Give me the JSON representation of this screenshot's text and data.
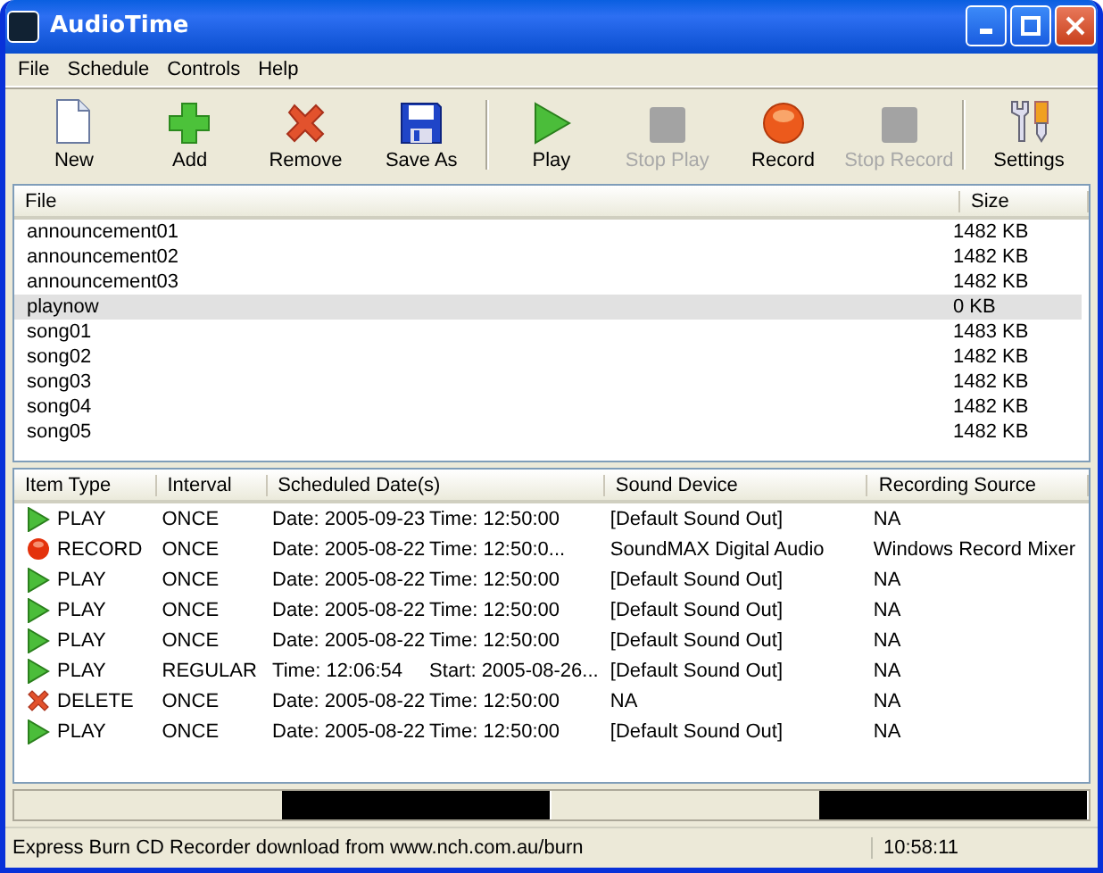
{
  "window": {
    "title": "AudioTime"
  },
  "menu": [
    "File",
    "Schedule",
    "Controls",
    "Help"
  ],
  "toolbar": [
    {
      "kind": "new",
      "label": "New",
      "disabled": false
    },
    {
      "kind": "add",
      "label": "Add",
      "disabled": false
    },
    {
      "kind": "remove",
      "label": "Remove",
      "disabled": false
    },
    {
      "kind": "save",
      "label": "Save As",
      "disabled": false
    },
    {
      "kind": "separator"
    },
    {
      "kind": "play",
      "label": "Play",
      "disabled": false
    },
    {
      "kind": "stop",
      "label": "Stop Play",
      "disabled": true
    },
    {
      "kind": "record",
      "label": "Record",
      "disabled": false
    },
    {
      "kind": "stop",
      "label": "Stop Record",
      "disabled": true
    },
    {
      "kind": "separator"
    },
    {
      "kind": "settings",
      "label": "Settings",
      "disabled": false
    }
  ],
  "files": {
    "columns": [
      "File",
      "Size"
    ],
    "rows": [
      {
        "name": "announcement01",
        "size": "1482 KB",
        "selected": false
      },
      {
        "name": "announcement02",
        "size": "1482 KB",
        "selected": false
      },
      {
        "name": "announcement03",
        "size": "1482 KB",
        "selected": false
      },
      {
        "name": "playnow",
        "size": "0 KB",
        "selected": true
      },
      {
        "name": "song01",
        "size": "1483 KB",
        "selected": false
      },
      {
        "name": "song02",
        "size": "1482 KB",
        "selected": false
      },
      {
        "name": "song03",
        "size": "1482 KB",
        "selected": false
      },
      {
        "name": "song04",
        "size": "1482 KB",
        "selected": false
      },
      {
        "name": "song05",
        "size": "1482 KB",
        "selected": false
      }
    ]
  },
  "schedule": {
    "columns": [
      "Item Type",
      "Interval",
      "Scheduled Date(s)",
      "Sound Device",
      "Recording Source"
    ],
    "rows": [
      {
        "kind": "play",
        "type": "PLAY",
        "interval": "ONCE",
        "dates": [
          "Date: 2005-09-23",
          "Time: 12:50:00"
        ],
        "device": "[Default Sound Out]",
        "source": "NA"
      },
      {
        "kind": "record",
        "type": "RECORD",
        "interval": "ONCE",
        "dates": [
          "Date: 2005-08-22",
          "Time: 12:50:0..."
        ],
        "device": "SoundMAX Digital Audio",
        "source": "Windows Record Mixer"
      },
      {
        "kind": "play",
        "type": "PLAY",
        "interval": "ONCE",
        "dates": [
          "Date: 2005-08-22",
          "Time: 12:50:00"
        ],
        "device": "[Default Sound Out]",
        "source": "NA"
      },
      {
        "kind": "play",
        "type": "PLAY",
        "interval": "ONCE",
        "dates": [
          "Date: 2005-08-22",
          "Time: 12:50:00"
        ],
        "device": "[Default Sound Out]",
        "source": "NA"
      },
      {
        "kind": "play",
        "type": "PLAY",
        "interval": "ONCE",
        "dates": [
          "Date: 2005-08-22",
          "Time: 12:50:00"
        ],
        "device": "[Default Sound Out]",
        "source": "NA"
      },
      {
        "kind": "play",
        "type": "PLAY",
        "interval": "REGULAR",
        "dates": [
          "Time: 12:06:54",
          "Start: 2005-08-26..."
        ],
        "device": "[Default Sound Out]",
        "source": "NA"
      },
      {
        "kind": "delete",
        "type": "DELETE",
        "interval": "ONCE",
        "dates": [
          "Date: 2005-08-22",
          "Time: 12:50:00"
        ],
        "device": "NA",
        "source": "NA"
      },
      {
        "kind": "play",
        "type": "PLAY",
        "interval": "ONCE",
        "dates": [
          "Date: 2005-08-22",
          "Time: 12:50:00"
        ],
        "device": "[Default Sound Out]",
        "source": "NA"
      }
    ]
  },
  "meters": [
    {
      "level": 0.5
    },
    {
      "level": 0.5
    }
  ],
  "status_bar": {
    "message": "Express Burn CD Recorder download from www.nch.com.au/burn",
    "time": "10:58:11"
  }
}
